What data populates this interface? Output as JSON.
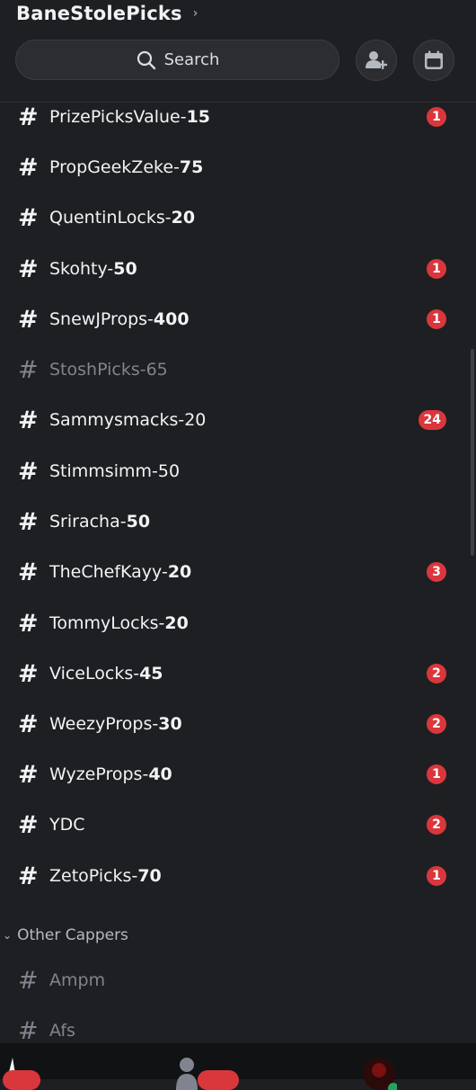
{
  "header": {
    "server_name": "BaneStolePicks",
    "chevron": "›",
    "search_label": "Search"
  },
  "channels": [
    {
      "prefix": "PrizePicksValue-",
      "price": "15",
      "badge": "1"
    },
    {
      "prefix": "PropGeekZeke-",
      "price": "75",
      "badge": ""
    },
    {
      "prefix": "QuentinLocks-",
      "price": "20",
      "badge": ""
    },
    {
      "prefix": "Skohty-",
      "price": "50",
      "badge": "1"
    },
    {
      "prefix": "SnewJProps-",
      "price": "400",
      "badge": "1"
    },
    {
      "prefix": "StoshPicks-65",
      "price": "",
      "badge": ""
    },
    {
      "prefix": "Sammysmacks-20",
      "price": "",
      "badge": "24"
    },
    {
      "prefix": "Stimmsimm-50",
      "price": "",
      "badge": ""
    },
    {
      "prefix": "Sriracha-",
      "price": "50",
      "badge": ""
    },
    {
      "prefix": "TheChefKayy-",
      "price": "20",
      "badge": "3"
    },
    {
      "prefix": "TommyLocks-",
      "price": "20",
      "badge": ""
    },
    {
      "prefix": "ViceLocks-",
      "price": "45",
      "badge": "2"
    },
    {
      "prefix": "WeezyProps-",
      "price": "30",
      "badge": "2"
    },
    {
      "prefix": "WyzeProps-",
      "price": "40",
      "badge": "1"
    },
    {
      "prefix": "YDC",
      "price": "",
      "badge": "2"
    },
    {
      "prefix": "ZetoPicks-",
      "price": "70",
      "badge": "1"
    }
  ],
  "category": {
    "label": "Other Cappers",
    "channels": [
      {
        "prefix": "Ampm"
      },
      {
        "prefix": "Afs"
      }
    ]
  },
  "colors": {
    "background": "#1e1f22",
    "badge": "#da373c",
    "muted_text": "#80848e"
  },
  "icons": {
    "search": "search-icon",
    "invite": "invite-user-icon",
    "events": "calendar-icon"
  }
}
